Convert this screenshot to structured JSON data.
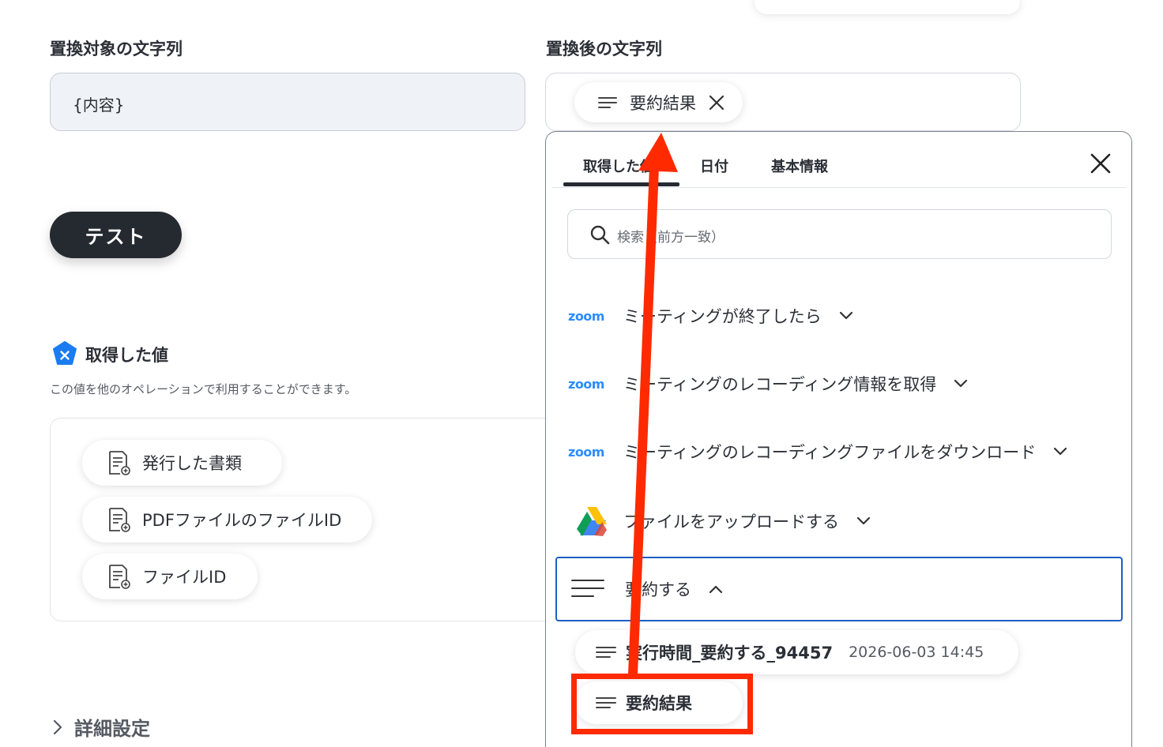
{
  "form": {
    "target_label": "置換対象の文字列",
    "target_value": "{内容}",
    "result_label": "置換後の文字列",
    "result_chip": "要約結果"
  },
  "test_button": "テスト",
  "values": {
    "title": "取得した値",
    "description": "この値を他のオペレーションで利用することができます。",
    "items": [
      "発行した書類",
      "PDFファイルのファイルID",
      "ファイルID"
    ]
  },
  "detail_settings": "詳細設定",
  "picker": {
    "tabs": [
      "取得した値",
      "日付",
      "基本情報"
    ],
    "search_placeholder": "検索（前方一致）",
    "operations": [
      {
        "logo": "zoom",
        "label": "ミーティングが終了したら",
        "state": "collapsed"
      },
      {
        "logo": "zoom",
        "label": "ミーティングのレコーディング情報を取得",
        "state": "collapsed"
      },
      {
        "logo": "zoom",
        "label": "ミーティングのレコーディングファイルをダウンロード",
        "state": "collapsed"
      },
      {
        "logo": "google-drive-icon",
        "label": "ファイルをアップロードする",
        "state": "collapsed"
      },
      {
        "logo": "lines-icon",
        "label": "要約する",
        "state": "expanded"
      }
    ],
    "sub_items": [
      {
        "label": "実行時間_要約する_94457",
        "timestamp": "2026-06-03 14:45"
      },
      {
        "label": "要約結果"
      }
    ]
  },
  "colors": {
    "accent": "#1c5fc4",
    "annotation": "#ff2a00",
    "zoom": "#2d8cff",
    "dark_button": "#252a31"
  }
}
